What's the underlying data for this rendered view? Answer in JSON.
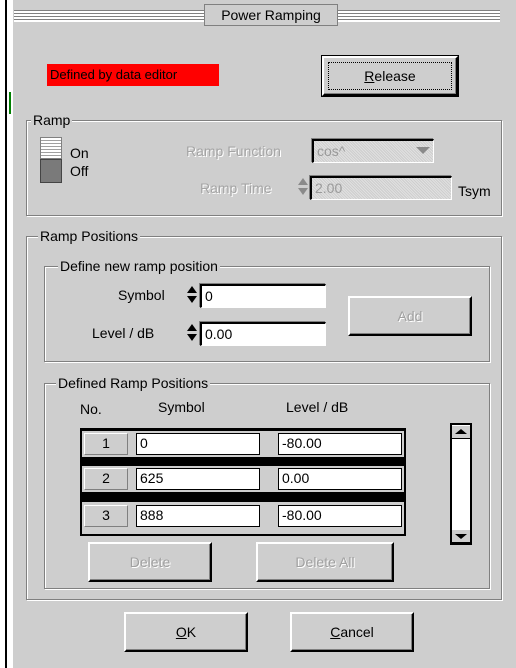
{
  "window": {
    "title": "Power Ramping"
  },
  "status": {
    "text": "Defined by data editor",
    "color": "#ff0000"
  },
  "release_button": {
    "label": "Release",
    "mnemonic": "R"
  },
  "ramp": {
    "legend": "Ramp",
    "switch_on": "On",
    "switch_off": "Off",
    "state": "Off",
    "function_label": "Ramp Function",
    "function_value": "cos^",
    "time_label": "Ramp Time",
    "time_value": "2.00",
    "time_unit": "Tsym"
  },
  "positions": {
    "legend": "Ramp Positions",
    "define_new": {
      "legend": "Define new  ramp position",
      "symbol_label": "Symbol",
      "symbol_value": "0",
      "level_label": "Level / dB",
      "level_value": "0.00",
      "add_label": "Add"
    },
    "defined": {
      "legend": "Defined Ramp Positions",
      "columns": {
        "no": "No.",
        "symbol": "Symbol",
        "level": "Level / dB"
      },
      "rows": [
        {
          "no": "1",
          "symbol": "0",
          "level": "-80.00"
        },
        {
          "no": "2",
          "symbol": "625",
          "level": "0.00"
        },
        {
          "no": "3",
          "symbol": "888",
          "level": "-80.00"
        }
      ],
      "delete_label": "Delete",
      "delete_all_label": "Delete All"
    }
  },
  "ok_button": {
    "label": "OK",
    "mnemonic": "O"
  },
  "cancel_button": {
    "label": "Cancel",
    "mnemonic": "C"
  },
  "icons": [
    "spin-up-down-icon",
    "dropdown-arrow-icon",
    "scroll-up-icon",
    "scroll-down-icon"
  ]
}
